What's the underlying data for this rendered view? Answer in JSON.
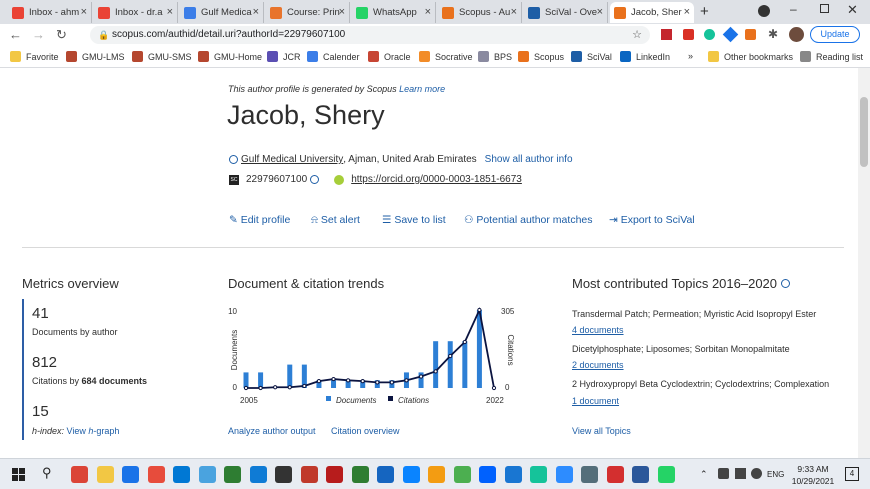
{
  "browser": {
    "tabs": [
      {
        "label": "Inbox - ahm",
        "icon": "gmail-icon",
        "color": "#ea4335"
      },
      {
        "label": "Inbox - dr.a",
        "icon": "gmail-icon",
        "color": "#ea4335"
      },
      {
        "label": "Gulf Medica",
        "icon": "google-sheets-icon",
        "color": "#3c7ee8"
      },
      {
        "label": "Course: Prin",
        "icon": "moodle-icon",
        "color": "#e8742c"
      },
      {
        "label": "WhatsApp",
        "icon": "whatsapp-icon",
        "color": "#25d366"
      },
      {
        "label": "Scopus - Au",
        "icon": "scopus-icon",
        "color": "#e9711c"
      },
      {
        "label": "SciVal - Ove",
        "icon": "scival-icon",
        "color": "#1e5ea6"
      },
      {
        "label": "Jacob, Sher",
        "icon": "scopus-icon",
        "color": "#e9711c",
        "active": true
      }
    ],
    "new_tab": "+",
    "url": "scopus.com/authid/detail.uri?authorId=22979607100",
    "update_label": "Update",
    "bookmarks": [
      {
        "label": "Favorite",
        "icon": "folder-icon",
        "color": "#f2c744"
      },
      {
        "label": "GMU-LMS",
        "icon": "shield-icon",
        "color": "#b5472f"
      },
      {
        "label": "GMU-SMS",
        "icon": "shield-icon",
        "color": "#b5472f"
      },
      {
        "label": "GMU-Home",
        "icon": "shield-icon",
        "color": "#b5472f"
      },
      {
        "label": "JCR",
        "icon": "clarivate-icon",
        "color": "#5b4fb3"
      },
      {
        "label": "Calender",
        "icon": "calendar-icon",
        "color": "#3c7ee8"
      },
      {
        "label": "Oracle",
        "icon": "oracle-icon",
        "color": "#c74634"
      },
      {
        "label": "Socrative",
        "icon": "socrative-icon",
        "color": "#f28c28"
      },
      {
        "label": "BPS",
        "icon": "bps-icon",
        "color": "#8a8aa0"
      },
      {
        "label": "Scopus",
        "icon": "scopus-icon",
        "color": "#e9711c"
      },
      {
        "label": "SciVal",
        "icon": "scival-icon",
        "color": "#1e5ea6"
      },
      {
        "label": "LinkedIn",
        "icon": "linkedin-icon",
        "color": "#0a66c2"
      }
    ],
    "more_bookmarks": "»",
    "other_bookmarks": "Other bookmarks",
    "reading_list": "Reading list"
  },
  "profile": {
    "notice": "This author profile is generated by Scopus",
    "notice_link": "Learn more",
    "name": "Jacob, Shery",
    "affiliation_link": "Gulf Medical University",
    "affiliation_rest": ", Ajman, United Arab Emirates",
    "show_info": "Show all author info",
    "scopus_id": "22979607100",
    "orcid": "https://orcid.org/0000-0003-1851-6673",
    "actions": [
      "Edit profile",
      "Set alert",
      "Save to list",
      "Potential author matches",
      "Export to SciVal"
    ]
  },
  "metrics": {
    "title": "Metrics overview",
    "documents": "41",
    "documents_label": "Documents by author",
    "citations": "812",
    "citations_label_prefix": "Citations by ",
    "citations_label_bold": "684 documents",
    "hindex": "15",
    "hindex_label": "h-index:",
    "hindex_link_prefix": "View ",
    "hindex_link_italic": "h",
    "hindex_link_suffix": "-graph"
  },
  "trends": {
    "title": "Document & citation trends",
    "left_axis_label": "Documents",
    "right_axis_label": "Citations",
    "left_max_label": "10",
    "left_min_label": "0",
    "right_max_label": "305",
    "right_min_label": "0",
    "x_start": "2005",
    "x_end": "2022",
    "legend_documents": "Documents",
    "legend_citations": "Citations",
    "link_analyze": "Analyze author output",
    "link_citation": "Citation overview"
  },
  "chart_data": {
    "type": "bar",
    "x": [
      2005,
      2006,
      2007,
      2008,
      2009,
      2010,
      2011,
      2012,
      2013,
      2014,
      2015,
      2016,
      2017,
      2018,
      2019,
      2020,
      2021,
      2022
    ],
    "series": [
      {
        "name": "Documents",
        "type": "bar",
        "axis": "left",
        "values": [
          2,
          2,
          0,
          3,
          3,
          1,
          1,
          1,
          1,
          1,
          1,
          2,
          2,
          6,
          6,
          6,
          10,
          0
        ]
      },
      {
        "name": "Citations",
        "type": "line",
        "axis": "right",
        "values": [
          0,
          0,
          3,
          3,
          8,
          27,
          35,
          30,
          27,
          22,
          22,
          30,
          45,
          65,
          125,
          180,
          305,
          0
        ]
      }
    ],
    "ylim_left": [
      0,
      10
    ],
    "ylim_right": [
      0,
      305
    ],
    "xlabel": "",
    "ylabel_left": "Documents",
    "ylabel_right": "Citations",
    "legend": "bottom",
    "colors": {
      "documents": "#2d7fd5",
      "citations": "#0b1440"
    }
  },
  "topics": {
    "title": "Most contributed Topics 2016–2020",
    "items": [
      {
        "name": "Transdermal Patch; Permeation; Myristic Acid Isopropyl Ester",
        "docs": "4 documents"
      },
      {
        "name": "Dicetylphosphate; Liposomes; Sorbitan Monopalmitate",
        "docs": "2 documents"
      },
      {
        "name": "2 Hydroxypropyl Beta Cyclodextrin; Cyclodextrins; Complexation",
        "docs": "1 document"
      }
    ],
    "view_all": "View all Topics"
  },
  "taskbar": {
    "time": "9:33 AM",
    "date": "10/29/2021",
    "lang": "ENG",
    "notifications": "4"
  }
}
